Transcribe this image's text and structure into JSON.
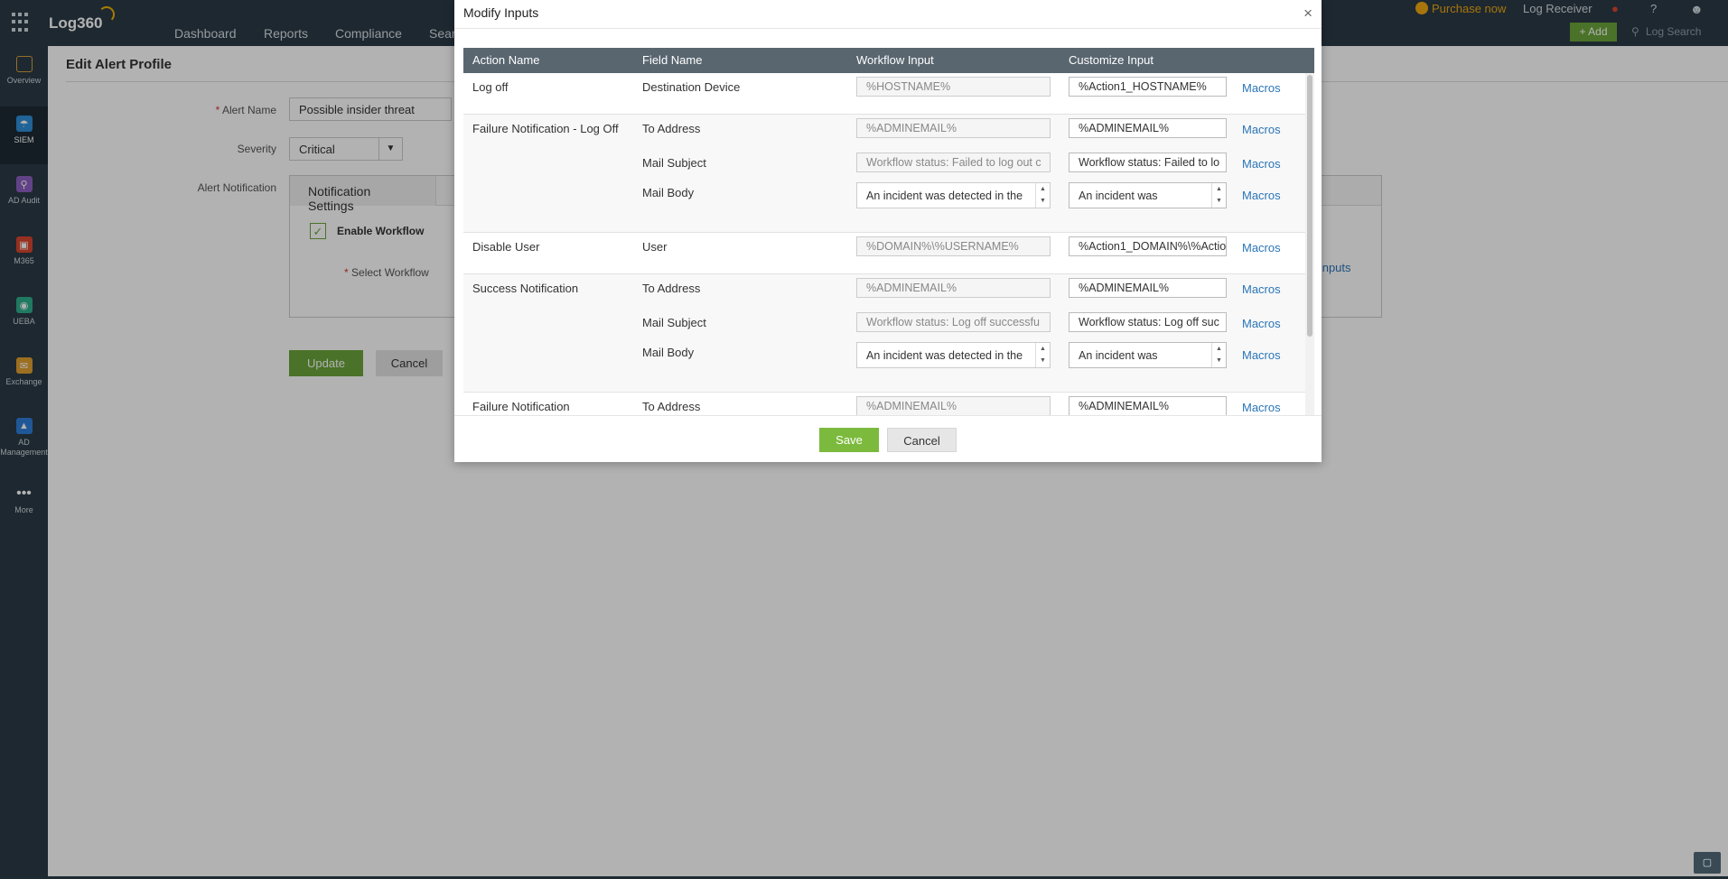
{
  "nav": {
    "items": [
      {
        "label": "Overview",
        "icon": "overview-icon",
        "color": "#d6a040"
      },
      {
        "label": "SIEM",
        "icon": "siem-shield-icon",
        "color": "#2f8fd8"
      },
      {
        "label": "AD Audit",
        "icon": "ad-audit-icon",
        "color": "#8b5fc0"
      },
      {
        "label": "M365",
        "icon": "m365-icon",
        "color": "#d9452f"
      },
      {
        "label": "UEBA",
        "icon": "ueba-eye-icon",
        "color": "#2fae8c"
      },
      {
        "label": "Exchange",
        "icon": "exchange-mail-icon",
        "color": "#e0a030"
      },
      {
        "label": "AD\nManagement",
        "icon": "ad-management-icon",
        "color": "#2f7fd8"
      },
      {
        "label": "More",
        "icon": "more-dots-icon",
        "color": "#cfd8de"
      }
    ]
  },
  "header": {
    "logo": "Log360",
    "nav": [
      "Dashboard",
      "Reports",
      "Compliance",
      "Sear"
    ],
    "purchase": "Purchase now",
    "log_receiver": "Log Receiver",
    "help": "?",
    "add": "+ Add",
    "log_search": "Log Search"
  },
  "page": {
    "title": "Edit Alert Profile",
    "alert_name_label": "Alert Name",
    "alert_name_value": "Possible insider threat",
    "severity_label": "Severity",
    "severity_value": "Critical",
    "alert_notification_label": "Alert Notification",
    "notification_tab": "Notification Settings",
    "enable_workflow": "Enable Workflow",
    "select_workflow_label": "Select Workflow",
    "modify_inputs_link": "y Inputs",
    "update": "Update",
    "cancel": "Cancel",
    "required_mark": "*"
  },
  "modal": {
    "title": "Modify Inputs",
    "close": "×",
    "columns": [
      "Action Name",
      "Field Name",
      "Workflow Input",
      "Customize Input"
    ],
    "rows": [
      {
        "action": "Log off",
        "fields": [
          {
            "field": "Destination Device",
            "workflow": "%HOSTNAME%",
            "custom": "%Action1_HOSTNAME%",
            "macros": "Macros",
            "multiline": false
          }
        ]
      },
      {
        "action": "Failure Notification - Log Off",
        "fields": [
          {
            "field": "To Address",
            "workflow": "%ADMINEMAIL%",
            "custom": "%ADMINEMAIL%",
            "macros": "Macros",
            "multiline": false
          },
          {
            "field": "Mail Subject",
            "workflow": "Workflow status: Failed to log out c",
            "custom": "Workflow status: Failed to lo",
            "macros": "Macros",
            "multiline": false
          },
          {
            "field": "Mail Body",
            "workflow": "An incident was detected in the",
            "custom": "An incident was",
            "macros": "Macros",
            "multiline": true
          }
        ]
      },
      {
        "action": "Disable User",
        "fields": [
          {
            "field": "User",
            "workflow": "%DOMAIN%\\%USERNAME%",
            "custom": "%Action1_DOMAIN%\\%Actio",
            "macros": "Macros",
            "multiline": false
          }
        ]
      },
      {
        "action": "Success Notification",
        "fields": [
          {
            "field": "To Address",
            "workflow": "%ADMINEMAIL%",
            "custom": "%ADMINEMAIL%",
            "macros": "Macros",
            "multiline": false
          },
          {
            "field": "Mail Subject",
            "workflow": "Workflow status: Log off successfu",
            "custom": "Workflow status: Log off suc",
            "macros": "Macros",
            "multiline": false
          },
          {
            "field": "Mail Body",
            "workflow": "An incident was detected in the",
            "custom": "An incident was",
            "macros": "Macros",
            "multiline": true
          }
        ]
      },
      {
        "action": "Failure Notification",
        "fields": [
          {
            "field": "To Address",
            "workflow": "%ADMINEMAIL%",
            "custom": "%ADMINEMAIL%",
            "macros": "Macros",
            "multiline": false
          }
        ]
      }
    ],
    "save": "Save",
    "cancel": "Cancel"
  },
  "colors": {
    "nav_bg": "#2b3a45",
    "accent_green": "#7cba3d",
    "link_blue": "#2a75b8",
    "grid_header": "#596670",
    "purchase_orange": "#f0a810"
  }
}
